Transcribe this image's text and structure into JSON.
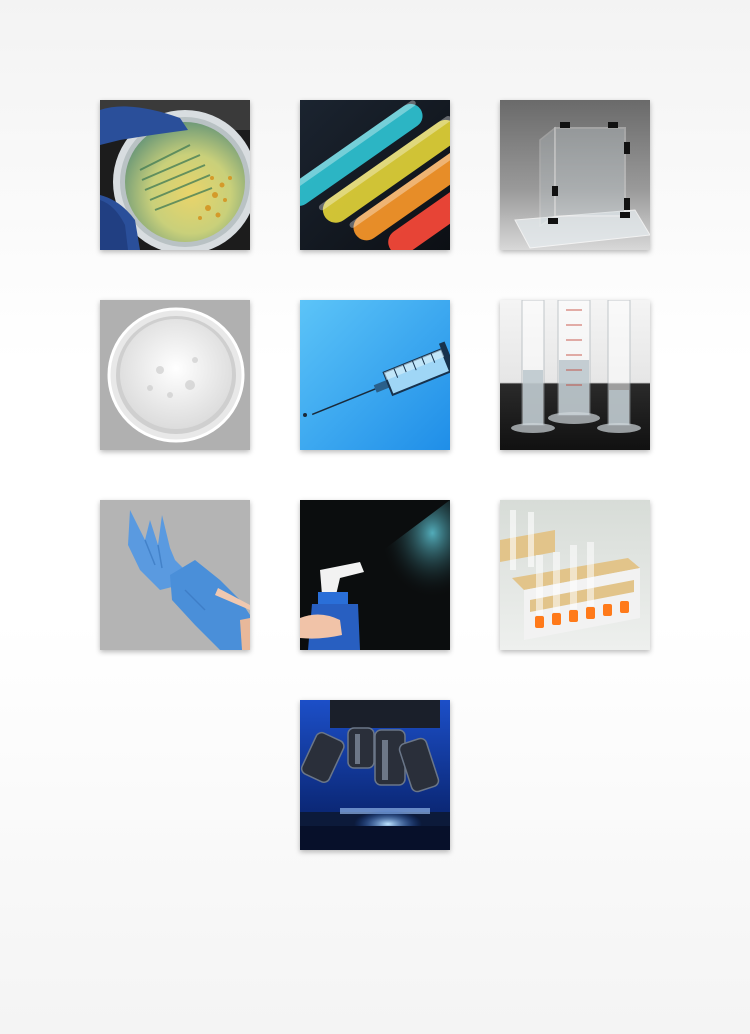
{
  "gallery": {
    "items": [
      {
        "icon": "petri-dish-culture-icon"
      },
      {
        "icon": "glowing-test-tubes-icon"
      },
      {
        "icon": "acrylic-glove-box-icon"
      },
      {
        "icon": "powder-dish-icon"
      },
      {
        "icon": "syringe-icon"
      },
      {
        "icon": "graduated-cylinders-icon"
      },
      {
        "icon": "nitrile-gloves-icon"
      },
      {
        "icon": "spray-bottle-icon"
      },
      {
        "icon": "test-tube-rack-icon"
      },
      {
        "icon": "microscope-icon"
      }
    ],
    "colors": {
      "background": "#f6f6f6",
      "glove_blue": "#4a8fd9",
      "syringe_blue": "#3aa6f0",
      "microscope_blue": "#1e5fd8"
    }
  }
}
